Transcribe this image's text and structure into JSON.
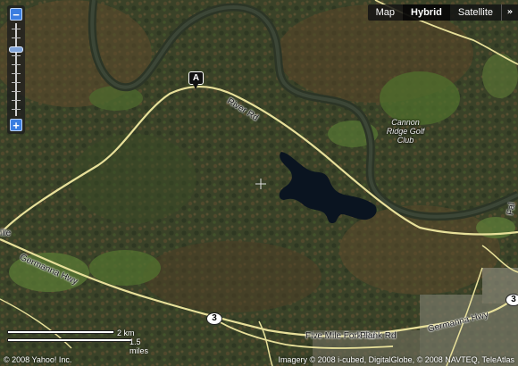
{
  "map_types": {
    "map": "Map",
    "hybrid": "Hybrid",
    "satellite": "Satellite",
    "more": "»",
    "active": "Hybrid"
  },
  "zoom": {
    "in": "+",
    "out": "−",
    "level_fraction": 0.72
  },
  "marker": {
    "label": "A"
  },
  "roads": {
    "river_rd": "River Rd",
    "germanna_hwy_w": "Germanna Hwy",
    "germanna_hwy_e": "Germanna Hwy",
    "five_mile_fork_rd": "Five Mile Fork Rd",
    "plank_rd": "Plank Rd",
    "ille": "ille",
    "fal": "Fal"
  },
  "poi": {
    "golf": "Cannon Ridge Golf Club"
  },
  "shields": {
    "route_3_a": "3",
    "route_3_b": "3"
  },
  "scale": {
    "km": "2 km",
    "mi": "1.5 miles"
  },
  "copyright": {
    "left": "© 2008 Yahoo! Inc.",
    "right": "Imagery © 2008 i-cubed, DigitalGlobe, © 2008 NAVTEQ, TeleAtlas"
  },
  "colors": {
    "forest_dark": "#2f3a22",
    "forest_brown": "#5a4a2e",
    "field_green": "#4d6a2e",
    "river": "#30392b",
    "lake": "#0a1420",
    "road": "#e8e09a",
    "accent_blue": "#3a7de0"
  }
}
